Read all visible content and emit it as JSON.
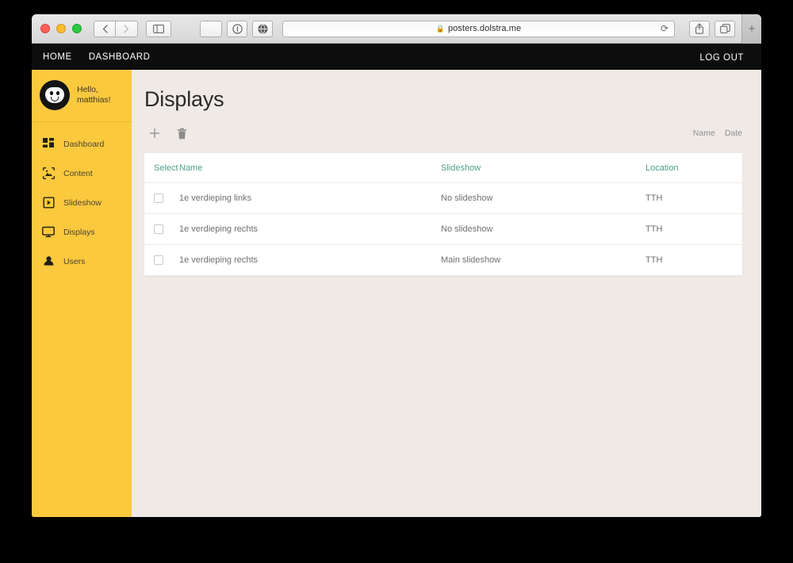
{
  "browser": {
    "url": "posters.dolstra.me",
    "lock_icon": "lock-icon",
    "reload_icon": "reload-icon",
    "back_icon": "back-arrow-icon",
    "forward_icon": "forward-arrow-icon",
    "sidebar_icon": "sidebar-toggle-icon",
    "share_icon": "share-icon",
    "tabs_icon": "show-tabs-icon",
    "new_tab_label": "+"
  },
  "top_nav": {
    "home_label": "HOME",
    "dashboard_label": "DASHBOARD",
    "logout_label": "LOG OUT"
  },
  "sidebar": {
    "greeting_line1": "Hello,",
    "greeting_line2": "matthias!",
    "avatar_icon": "user-avatar-icon",
    "items": [
      {
        "label": "Dashboard",
        "icon": "dashboard-grid-icon"
      },
      {
        "label": "Content",
        "icon": "content-image-icon"
      },
      {
        "label": "Slideshow",
        "icon": "slideshow-play-icon"
      },
      {
        "label": "Displays",
        "icon": "display-monitor-icon"
      },
      {
        "label": "Users",
        "icon": "users-person-icon"
      }
    ]
  },
  "main": {
    "title": "Displays",
    "add_label": "+",
    "add_icon": "plus-icon",
    "delete_icon": "trash-icon",
    "sort": {
      "name_label": "Name",
      "date_label": "Date"
    },
    "table": {
      "columns": [
        "Select",
        "Name",
        "Slideshow",
        "Location"
      ],
      "rows": [
        {
          "selected": false,
          "name": "1e verdieping links",
          "slideshow": "No slideshow",
          "location": "TTH"
        },
        {
          "selected": false,
          "name": "1e verdieping rechts",
          "slideshow": "No slideshow",
          "location": "TTH"
        },
        {
          "selected": false,
          "name": "1e verdieping rechts",
          "slideshow": "Main slideshow",
          "location": "TTH"
        }
      ]
    }
  },
  "colors": {
    "sidebar": "#fbc93d",
    "page_bg": "#efeae6",
    "nav_bg": "#0d0d0d",
    "table_header": "#4f9e8e",
    "card_bg": "#ffffff"
  }
}
